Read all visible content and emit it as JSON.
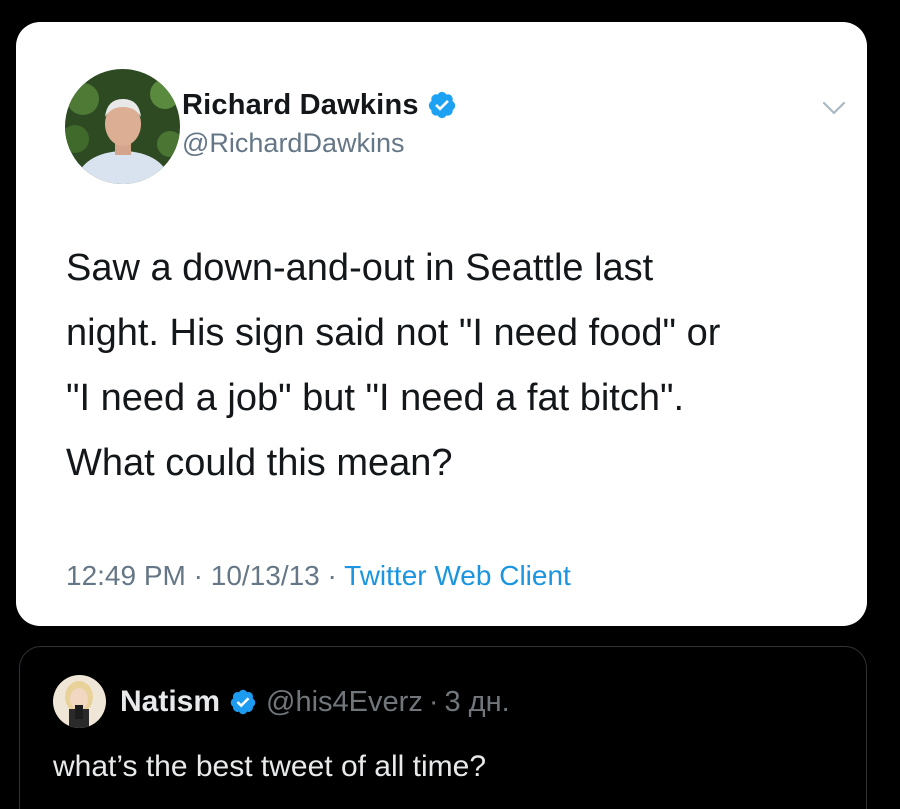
{
  "tweet": {
    "author_name": "Richard Dawkins",
    "author_handle": "@RichardDawkins",
    "verified_icon": "verified-badge-icon",
    "menu_icon": "chevron-down-icon",
    "text_lines": [
      "Saw a down-and-out in Seattle last",
      "night. His sign said not \"I need food\" or",
      "\"I need a job\" but \"I need a fat bitch\".",
      "What could this mean?"
    ],
    "time": "12:49 PM",
    "date": "10/13/13",
    "separator": "·",
    "source": "Twitter Web Client",
    "colors": {
      "name": "#14171a",
      "secondary": "#657786",
      "link": "#1b95e0",
      "verified": "#1da1f2"
    }
  },
  "post": {
    "author_name": "Natism",
    "author_handle": "@his4Everz",
    "separator": "·",
    "time": "3 дн.",
    "text": "what’s the best tweet of all time?",
    "verified_icon": "verified-badge-icon",
    "colors": {
      "background": "#000000",
      "text": "#e7e9ea",
      "secondary": "#71767b",
      "verified": "#1d9bf0"
    }
  }
}
